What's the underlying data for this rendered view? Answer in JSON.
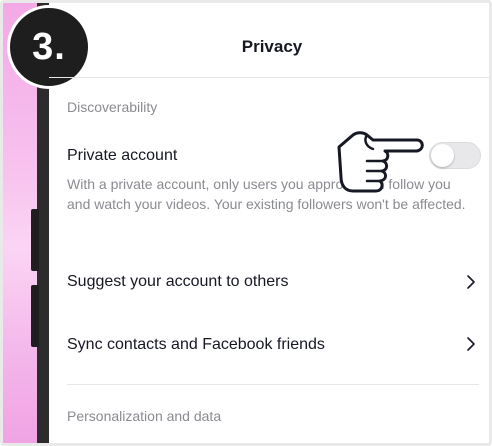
{
  "step_badge": "3.",
  "header": {
    "title": "Privacy"
  },
  "sections": {
    "discoverability": "Discoverability",
    "personalization": "Personalization and data"
  },
  "private_account": {
    "label": "Private account",
    "toggle_on": false,
    "description": "With a private account, only users you approve can follow you and watch your videos. Your existing followers won't be affected."
  },
  "rows": [
    {
      "label": "Suggest your account to others"
    },
    {
      "label": "Sync contacts and Facebook friends"
    }
  ],
  "icons": {
    "chevron": "chevron-right-icon",
    "pointer": "pointing-hand-icon"
  },
  "colors": {
    "text_primary": "#161823",
    "text_secondary": "#8a8b91",
    "toggle_off": "#e8e8ea"
  }
}
